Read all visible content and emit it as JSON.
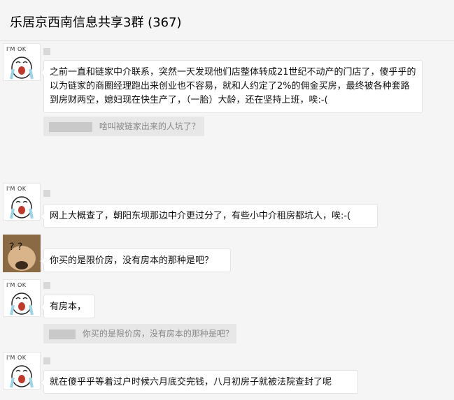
{
  "window": {
    "title": "乐居京西南信息共享3群 (367)"
  },
  "avatars": {
    "ok_label": "I'M OK",
    "dog_label": "? ?"
  },
  "messages": [
    {
      "id": "m1",
      "avatar": "im-ok",
      "text": "之前一直和链家中介联系，突然一天发现他们店整体转成21世纪不动产的门店了，傻乎乎的以为链家的商圈经理跑出来创业也不容易，就和人约定了2%的佣金买房，最终被各种套路到房财两空，媳妇现在快生产了，（一胎）大龄，还在坚持上班，唉:-("
    },
    {
      "id": "m2",
      "type": "quote",
      "text": "啥叫被链家出来的人坑了？"
    },
    {
      "id": "m3",
      "avatar": "im-ok",
      "text": "网上大概查了，朝阳东坝那边中介更过分了，有些小中介租房都坑人，唉:-("
    },
    {
      "id": "m4",
      "avatar": "dog",
      "text": "你买的是限价房，没有房本的那种是吧？"
    },
    {
      "id": "m5",
      "avatar": "im-ok",
      "text": "有房本，"
    },
    {
      "id": "m6",
      "type": "quote",
      "text": "你买的是限价房，没有房本的那种是吧？"
    },
    {
      "id": "m7",
      "avatar": "im-ok",
      "text": "就在傻乎乎等着过户时候六月底交完钱，八月初房子就被法院查封了呢"
    }
  ]
}
